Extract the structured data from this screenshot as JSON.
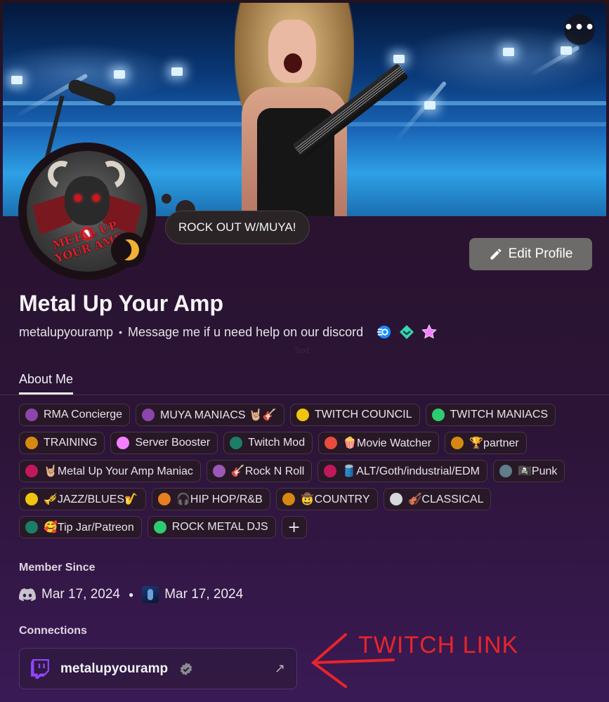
{
  "profile": {
    "display_name": "Metal Up Your Amp",
    "username": "metalupyouramp",
    "bio": "Message me if u need help on our discord",
    "custom_status": "ROCK OUT W/MUYA!",
    "avatar_text": "METAL UP YOUR AMP",
    "status": "idle",
    "hidden_label": "Text"
  },
  "actions": {
    "edit_profile": "Edit Profile",
    "more_icon": "ellipsis-icon"
  },
  "tabs": [
    {
      "label": "About Me",
      "active": true
    }
  ],
  "roles": [
    {
      "label": "RMA Concierge",
      "color": "#8e44ad"
    },
    {
      "label": "MUYA MANIACS 🤘🏼🎸",
      "color": "#8e44ad"
    },
    {
      "label": "TWITCH COUNCIL",
      "color": "#f1c40f"
    },
    {
      "label": "TWITCH MANIACS",
      "color": "#2ecc71"
    },
    {
      "label": "TRAINING",
      "color": "#d68910"
    },
    {
      "label": "Server Booster",
      "color": "#f47fff"
    },
    {
      "label": "Twitch Mod",
      "color": "#1a7f64"
    },
    {
      "label": "🍿Movie Watcher",
      "color": "#e74c3c"
    },
    {
      "label": "🏆partner",
      "color": "#d68910"
    },
    {
      "label": "🤘🏼Metal Up Your Amp Maniac",
      "color": "#c2185b"
    },
    {
      "label": "🎸Rock N Roll",
      "color": "#9b59b6"
    },
    {
      "label": "🛢️ALT/Goth/industrial/EDM",
      "color": "#c2185b"
    },
    {
      "label": "🏴‍☠️Punk",
      "color": "#607d8b"
    },
    {
      "label": "🎺JAZZ/BLUES🎷",
      "color": "#f1c40f"
    },
    {
      "label": "🎧HIP HOP/R&B",
      "color": "#e67e22"
    },
    {
      "label": "🤠COUNTRY",
      "color": "#d68910"
    },
    {
      "label": "🎻CLASSICAL",
      "color": "#d5d8dc"
    },
    {
      "label": "🥰Tip Jar/Patreon",
      "color": "#1a7f64"
    },
    {
      "label": "ROCK METAL DJS",
      "color": "#2ecc71"
    }
  ],
  "add_role": "+",
  "member_since": {
    "label": "Member Since",
    "discord_date": "Mar 17, 2024",
    "server_date": "Mar 17, 2024"
  },
  "connections": {
    "label": "Connections",
    "items": [
      {
        "platform": "twitch",
        "name": "metalupyouramp",
        "verified": true
      }
    ]
  },
  "annotation": {
    "text": "TWITCH LINK",
    "color": "#e8242a"
  },
  "colors": {
    "idle": "#f0b232",
    "twitch": "#9146ff"
  }
}
